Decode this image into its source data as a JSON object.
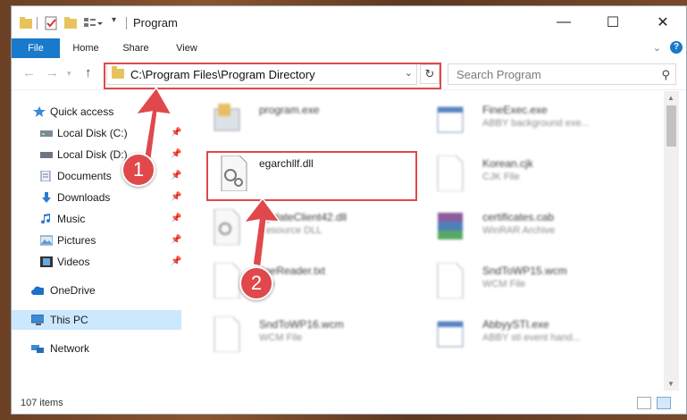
{
  "window": {
    "title": "Program",
    "controls": {
      "minimize": "—",
      "maximize": "☐",
      "close": "✕"
    }
  },
  "ribbon": {
    "tabs": [
      "File",
      "Home",
      "Share",
      "View"
    ],
    "help": "?"
  },
  "address": {
    "path": "C:\\Program Files\\Program Directory",
    "search_placeholder": "Search Program"
  },
  "sidebar": {
    "items": [
      {
        "label": "Quick access",
        "icon": "star-icon",
        "pinned": false
      },
      {
        "label": "Local Disk (C:)",
        "icon": "drive-icon",
        "pinned": true
      },
      {
        "label": "Local Disk (D:)",
        "icon": "drive-icon",
        "pinned": true
      },
      {
        "label": "Documents",
        "icon": "documents-icon",
        "pinned": true
      },
      {
        "label": "Downloads",
        "icon": "downloads-icon",
        "pinned": true
      },
      {
        "label": "Music",
        "icon": "music-icon",
        "pinned": true
      },
      {
        "label": "Pictures",
        "icon": "pictures-icon",
        "pinned": true
      },
      {
        "label": "Videos",
        "icon": "videos-icon",
        "pinned": true
      },
      {
        "label": "OneDrive",
        "icon": "cloud-icon",
        "pinned": false
      },
      {
        "label": "This PC",
        "icon": "pc-icon",
        "pinned": false,
        "selected": true
      },
      {
        "label": "Network",
        "icon": "network-icon",
        "pinned": false
      }
    ]
  },
  "files": [
    {
      "name": "program.exe",
      "type": ""
    },
    {
      "name": "FineExec.exe",
      "type": "ABBY background exe..."
    },
    {
      "name": "egarchllf.dll",
      "type": "",
      "highlighted": true
    },
    {
      "name": "Korean.cjk",
      "type": "CJK File"
    },
    {
      "name": "UpdateClient42.dll",
      "type": "Resource DLL"
    },
    {
      "name": "certificates.cab",
      "type": "WinRAR Archive"
    },
    {
      "name": "fineReader.txt",
      "type": "File"
    },
    {
      "name": "SndToWP15.wcm",
      "type": "WCM File"
    },
    {
      "name": "SndToWP16.wcm",
      "type": "WCM File"
    },
    {
      "name": "AbbyySTI.exe",
      "type": "ABBY sti event hand..."
    }
  ],
  "status": {
    "items": "107 items"
  },
  "callouts": [
    "1",
    "2"
  ],
  "colors": {
    "accent": "#1979ca",
    "highlight": "#e0484c",
    "selected": "#cce8ff"
  }
}
